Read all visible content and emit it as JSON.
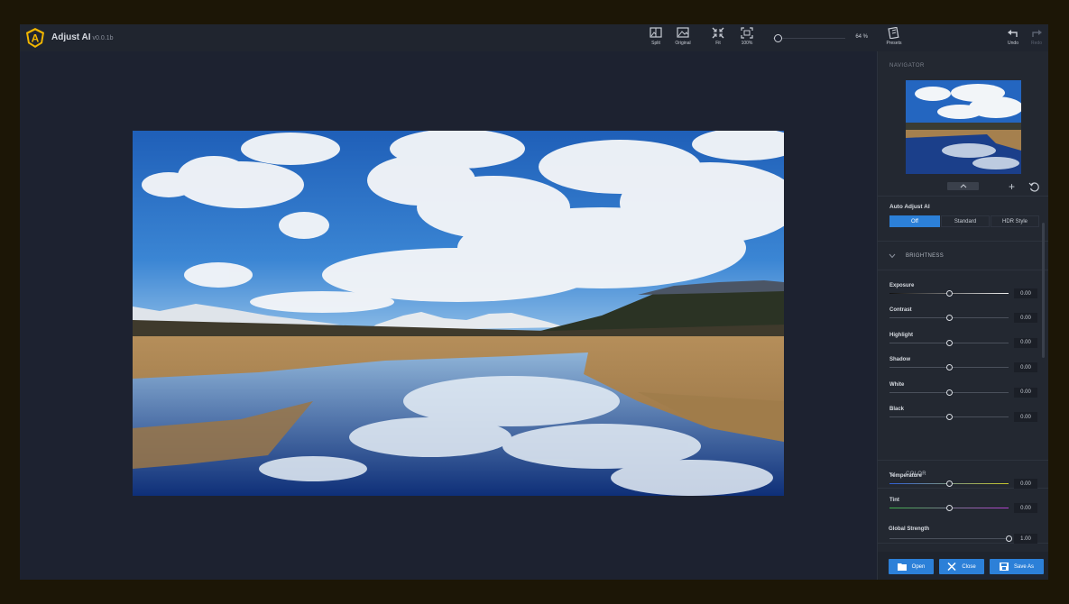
{
  "app": {
    "title": "Adjust AI",
    "version": "v0.0.1b",
    "logo_letter": "A",
    "accent_color": "#2c80d8",
    "logo_color": "#f2b600"
  },
  "toolbar": {
    "split_label": "Split",
    "original_label": "Original",
    "fit_label": "Fit",
    "zoom100_label": "100%",
    "zoom_value": "64 %",
    "presets_label": "Presets",
    "undo_label": "Undo",
    "redo_label": "Redo"
  },
  "navigator": {
    "title": "NAVIGATOR"
  },
  "auto_adjust": {
    "label": "Auto Adjust AI",
    "options": [
      "Off",
      "Standard",
      "HDR Style"
    ],
    "selected": "Off"
  },
  "brightness": {
    "title": "BRIGHTNESS",
    "sliders": [
      {
        "label": "Exposure",
        "value": "0.00",
        "position": 0.5
      },
      {
        "label": "Contrast",
        "value": "0.00",
        "position": 0.5
      },
      {
        "label": "Highlight",
        "value": "0.00",
        "position": 0.5
      },
      {
        "label": "Shadow",
        "value": "0.00",
        "position": 0.5
      },
      {
        "label": "White",
        "value": "0.00",
        "position": 0.5
      },
      {
        "label": "Black",
        "value": "0.00",
        "position": 0.5
      }
    ]
  },
  "color": {
    "title": "COLOR",
    "sliders": [
      {
        "label": "Temperature",
        "value": "0.00",
        "position": 0.5
      },
      {
        "label": "Tint",
        "value": "0.00",
        "position": 0.5
      }
    ]
  },
  "global_strength": {
    "label": "Global Strength",
    "value": "1.00",
    "position": 1.0
  },
  "footer": {
    "open_label": "Open",
    "close_label": "Close",
    "save_as_label": "Save As"
  }
}
